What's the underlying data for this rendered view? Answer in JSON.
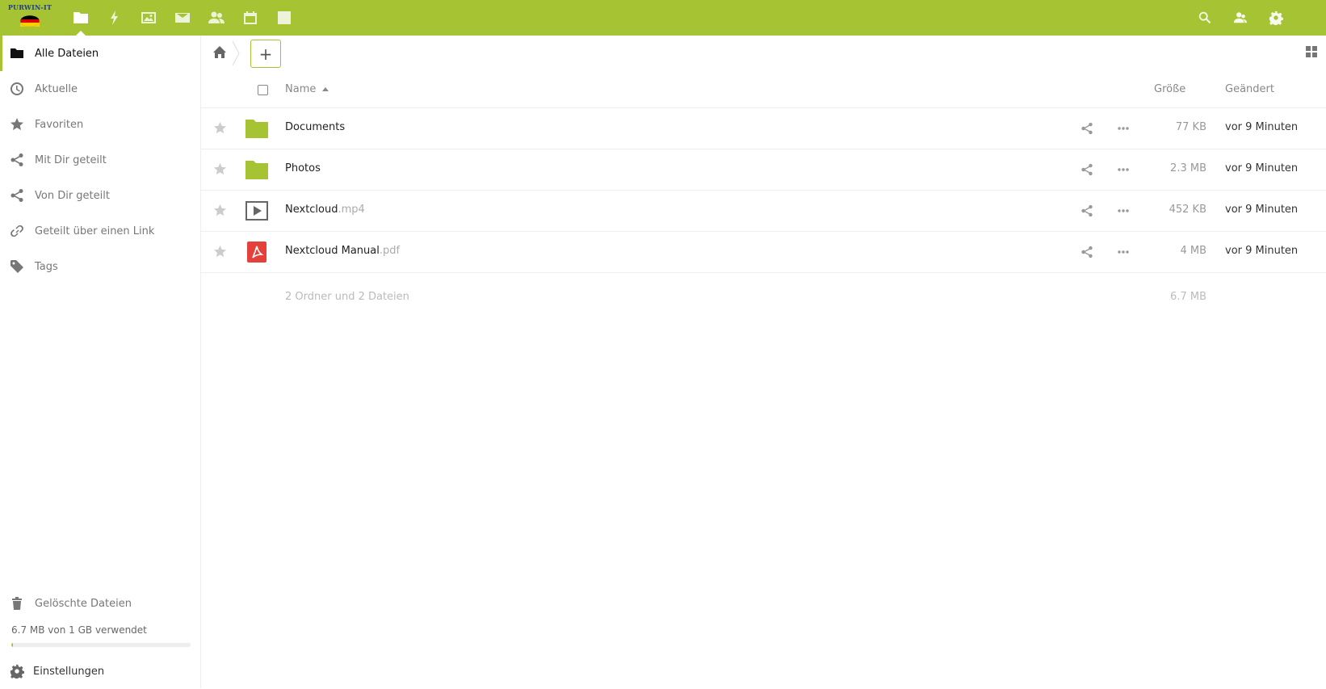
{
  "header": {
    "logo_text": "PURWIN-IT",
    "apps": [
      {
        "name": "Dateien",
        "icon": "folder-icon",
        "active": true
      },
      {
        "name": "Aktivität",
        "icon": "lightning-icon"
      },
      {
        "name": "Galerie",
        "icon": "image-icon"
      },
      {
        "name": "Mail",
        "icon": "mail-icon"
      },
      {
        "name": "Kontakte",
        "icon": "contacts-icon"
      },
      {
        "name": "Kalender",
        "icon": "calendar-icon"
      },
      {
        "name": "Notizen",
        "icon": "edit-icon"
      }
    ],
    "right_icons": [
      "search-icon",
      "contacts-menu-icon",
      "settings-gear-icon"
    ],
    "accent_color": "#a6c333"
  },
  "sidebar": {
    "items": [
      {
        "label": "Alle Dateien",
        "icon": "folder-icon",
        "active": true
      },
      {
        "label": "Aktuelle",
        "icon": "clock-icon"
      },
      {
        "label": "Favoriten",
        "icon": "star-icon"
      },
      {
        "label": "Mit Dir geteilt",
        "icon": "share-icon"
      },
      {
        "label": "Von Dir geteilt",
        "icon": "share-icon"
      },
      {
        "label": "Geteilt über einen Link",
        "icon": "link-icon"
      },
      {
        "label": "Tags",
        "icon": "tag-icon"
      }
    ],
    "deleted_files": "Gelöschte Dateien",
    "quota_text": "6.7 MB von 1 GB verwendet",
    "quota_fraction": 0.0067,
    "settings": "Einstellungen"
  },
  "main": {
    "new_button": "+",
    "columns": {
      "name": "Name",
      "size": "Größe",
      "modified": "Geändert"
    },
    "files": [
      {
        "base": "Documents",
        "ext": "",
        "type": "folder",
        "size": "77 KB",
        "modified": "vor 9 Minuten"
      },
      {
        "base": "Photos",
        "ext": "",
        "type": "folder",
        "size": "2.3 MB",
        "modified": "vor 9 Minuten"
      },
      {
        "base": "Nextcloud",
        "ext": ".mp4",
        "type": "video",
        "size": "452 KB",
        "modified": "vor 9 Minuten"
      },
      {
        "base": "Nextcloud Manual",
        "ext": ".pdf",
        "type": "pdf",
        "size": "4 MB",
        "modified": "vor 9 Minuten"
      }
    ],
    "summary_text": "2 Ordner und 2 Dateien",
    "summary_size": "6.7 MB"
  }
}
